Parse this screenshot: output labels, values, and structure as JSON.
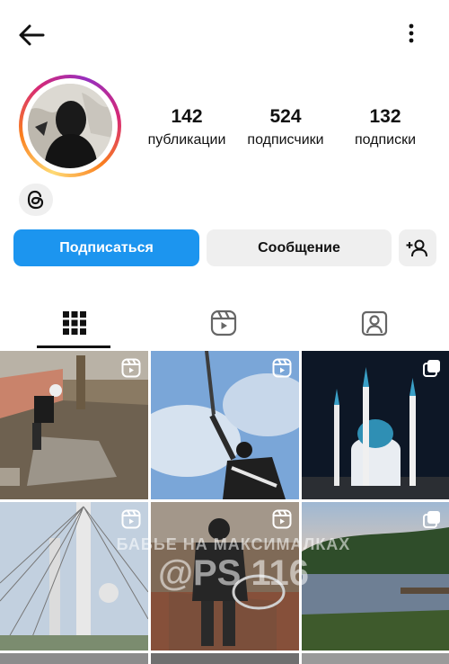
{
  "header": {
    "back_icon": "arrow-left-icon",
    "more_icon": "more-vertical-icon"
  },
  "profile": {
    "stats": [
      {
        "value": "142",
        "label": "публикации"
      },
      {
        "value": "524",
        "label": "подписчики"
      },
      {
        "value": "132",
        "label": "подписки"
      }
    ],
    "threads_icon": "threads-icon"
  },
  "actions": {
    "follow_label": "Подписаться",
    "message_label": "Сообщение",
    "add_person_icon": "add-person-icon",
    "follow_color": "#1c95ef"
  },
  "tabs": [
    {
      "icon": "grid-icon",
      "active": true
    },
    {
      "icon": "reels-icon",
      "active": false
    },
    {
      "icon": "tagged-icon",
      "active": false
    }
  ],
  "posts": [
    {
      "type": "reel",
      "badge": "reels-badge-icon"
    },
    {
      "type": "reel",
      "badge": "reels-badge-icon"
    },
    {
      "type": "carousel",
      "badge": "carousel-badge-icon"
    },
    {
      "type": "reel",
      "badge": "reels-badge-icon"
    },
    {
      "type": "reel",
      "badge": "reels-badge-icon"
    },
    {
      "type": "carousel",
      "badge": "carousel-badge-icon"
    }
  ],
  "watermark": {
    "line1": "БАБЬЕ НА МАКСИМАЛКАХ",
    "line2": "@PS 116"
  }
}
